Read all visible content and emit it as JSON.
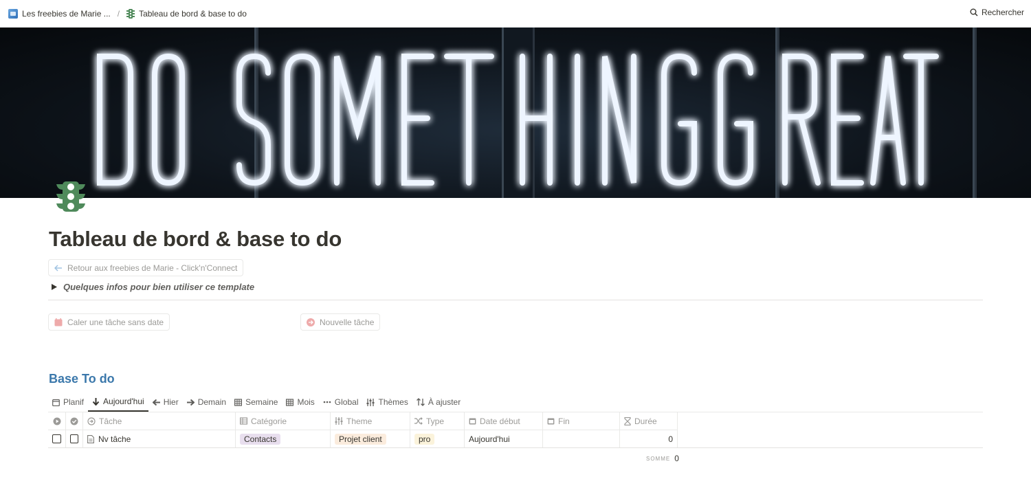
{
  "topbar": {
    "crumbs": [
      {
        "label": "Les freebies de Marie ...",
        "icon": "workspace-image-icon"
      },
      {
        "label": "Tableau de bord & base to do",
        "icon": "traffic-light-icon"
      }
    ],
    "separator": "/",
    "search_label": "Rechercher"
  },
  "cover": {
    "neon_text": "DO SOMETHING GREAT"
  },
  "page": {
    "icon": "traffic-light-icon",
    "icon_color": "#4f8a5b",
    "title": "Tableau de bord & base to do",
    "back_button": "Retour aux freebies de Marie - Click'n'Connect",
    "toggle_label": "Quelques infos pour bien utiliser ce template",
    "action_buttons": [
      "Caler une tâche sans date",
      "Nouvelle tâche"
    ]
  },
  "database": {
    "title": "Base To do",
    "title_color": "#3b78ab",
    "views": [
      {
        "label": "Planif",
        "icon": "calendar-icon"
      },
      {
        "label": "Aujourd'hui",
        "icon": "arrow-down-icon",
        "active": true
      },
      {
        "label": "Hier",
        "icon": "arrow-left-icon"
      },
      {
        "label": "Demain",
        "icon": "arrow-right-icon"
      },
      {
        "label": "Semaine",
        "icon": "table-icon"
      },
      {
        "label": "Mois",
        "icon": "table-icon"
      },
      {
        "label": "Global",
        "icon": "more-icon"
      },
      {
        "label": "Thèmes",
        "icon": "sliders-icon"
      },
      {
        "label": "À ajuster",
        "icon": "sort-icon"
      }
    ],
    "columns": [
      "Tâche",
      "Catégorie",
      "Theme",
      "Type",
      "Date début",
      "Fin",
      "Durée"
    ],
    "rows": [
      {
        "task": "Nv tâche",
        "category": "Contacts",
        "theme": "Projet client",
        "type": "pro",
        "start": "Aujourd'hui",
        "end": "",
        "duration": "0"
      }
    ],
    "summary_label": "SOMME",
    "summary_value": "0",
    "tag_colors": {
      "Contacts": "#e8deee",
      "Projet client": "#fbecdd",
      "pro": "#fbf3db"
    }
  }
}
